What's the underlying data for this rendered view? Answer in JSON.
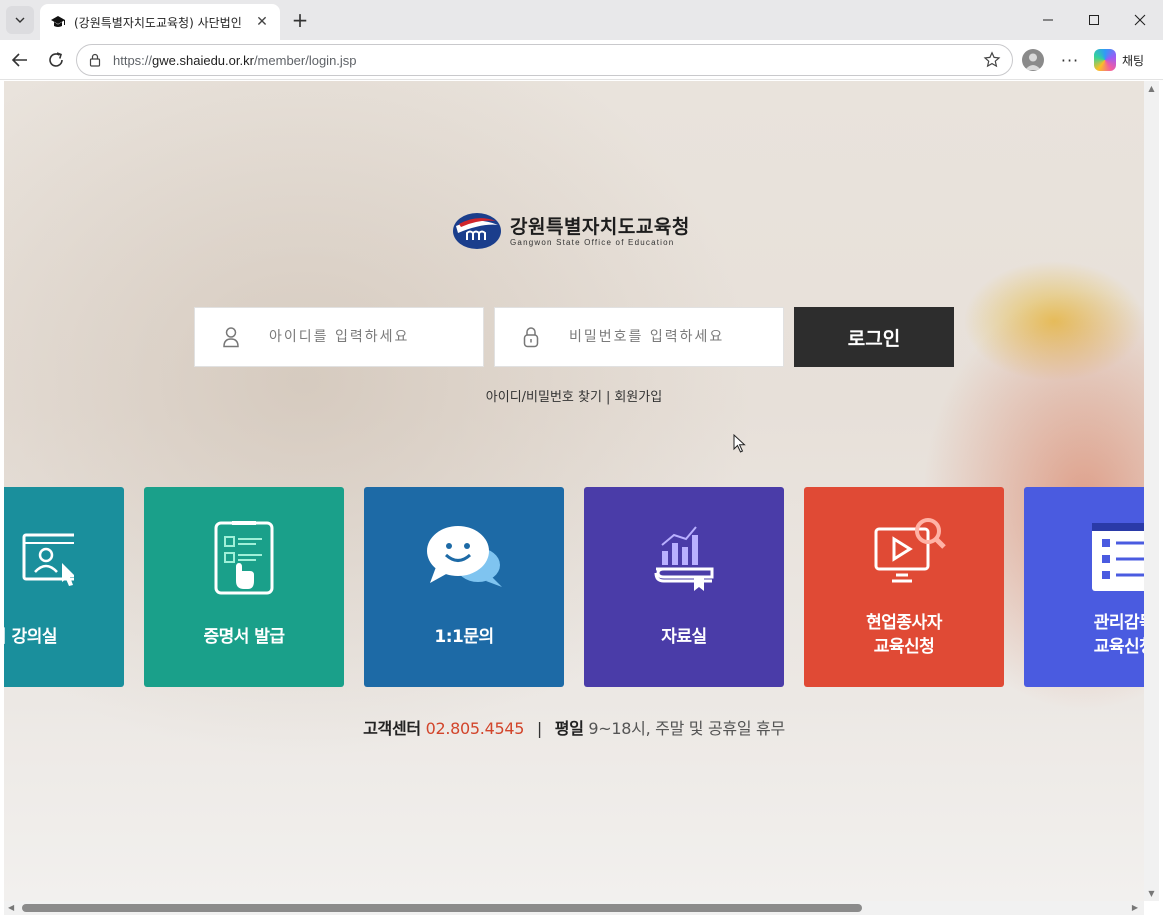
{
  "browser": {
    "tab_title": "(강원특별자치도교육청) 사단법인",
    "tab_close": "✕",
    "new_tab": "+",
    "url_prefix": "https://",
    "url_host": "gwe.shaiedu.or.kr",
    "url_path": "/member/login.jsp",
    "more": "···",
    "copilot_label": "채팅",
    "window_buttons": [
      "minimize",
      "maximize",
      "close"
    ]
  },
  "logo": {
    "title": "강원특별자치도교육청",
    "subtitle": "Gangwon State Office of Education"
  },
  "login": {
    "id_placeholder": "아이디를 입력하세요",
    "pw_placeholder": "비밀번호를 입력하세요",
    "button": "로그인",
    "find_link": "아이디/비밀번호 찾기",
    "divider": "|",
    "signup_link": "회원가입"
  },
  "tiles": [
    {
      "label": "의 강의실",
      "color": "#1a8f9c",
      "icon": "online-classroom-icon"
    },
    {
      "label": "증명서 발급",
      "color": "#1aa08a",
      "icon": "certificate-icon"
    },
    {
      "label": "1:1문의",
      "color": "#1d6aa6",
      "icon": "chat-smile-icon"
    },
    {
      "label": "자료실",
      "color": "#4a3ca8",
      "icon": "data-book-icon"
    },
    {
      "label": "현업종사자\n교육신청",
      "color": "#e04a35",
      "icon": "video-search-icon"
    },
    {
      "label": "관리감독\n교육신청",
      "color": "#4a5be0",
      "icon": "form-list-icon"
    }
  ],
  "customer_center": {
    "label": "고객센터",
    "phone": "02.805.4545",
    "sep": "|",
    "weekday_label": "평일",
    "hours": "9~18시, 주말 및 공휴일 휴무"
  }
}
